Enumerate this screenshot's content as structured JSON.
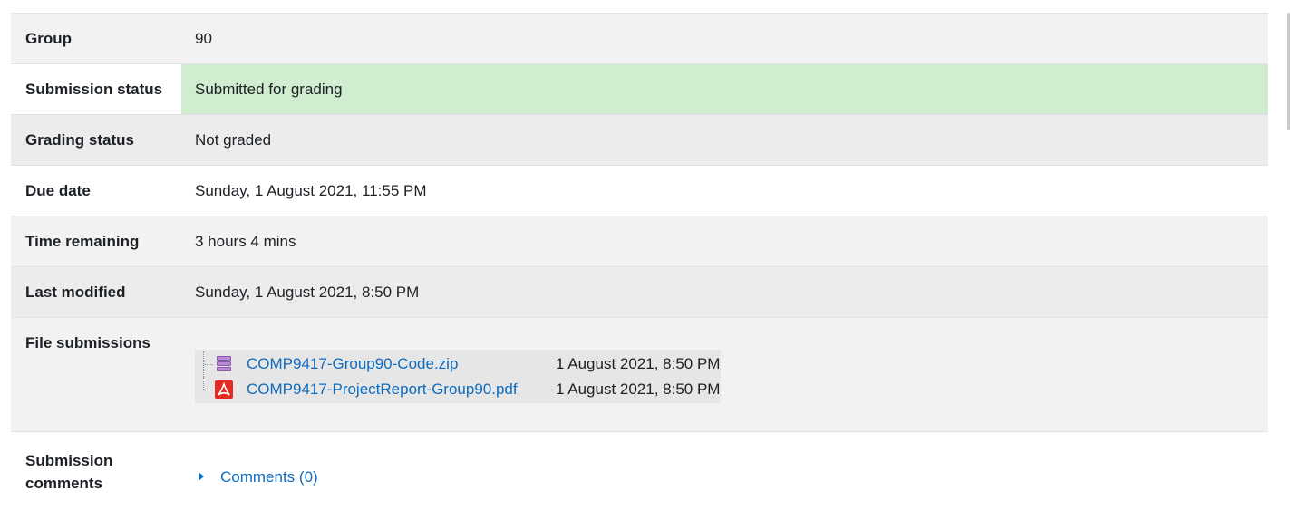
{
  "rows": {
    "group": {
      "label": "Group",
      "value": "90"
    },
    "submission_status": {
      "label": "Submission status",
      "value": "Submitted for grading"
    },
    "grading_status": {
      "label": "Grading status",
      "value": "Not graded"
    },
    "due_date": {
      "label": "Due date",
      "value": "Sunday, 1 August 2021, 11:55 PM"
    },
    "time_remaining": {
      "label": "Time remaining",
      "value": "3 hours 4 mins"
    },
    "last_modified": {
      "label": "Last modified",
      "value": "Sunday, 1 August 2021, 8:50 PM"
    },
    "file_submissions": {
      "label": "File submissions",
      "files": [
        {
          "name": "COMP9417-Group90-Code.zip",
          "date": "1 August 2021, 8:50 PM",
          "icon": "zip-file-icon"
        },
        {
          "name": "COMP9417-ProjectReport-Group90.pdf",
          "date": "1 August 2021, 8:50 PM",
          "icon": "pdf-file-icon"
        }
      ]
    },
    "submission_comments": {
      "label": "Submission comments",
      "link": "Comments (0)"
    }
  },
  "colors": {
    "submitted_bg": "#d0eecf",
    "link": "#0f6cbf",
    "row_alt": "#f2f2f2"
  }
}
